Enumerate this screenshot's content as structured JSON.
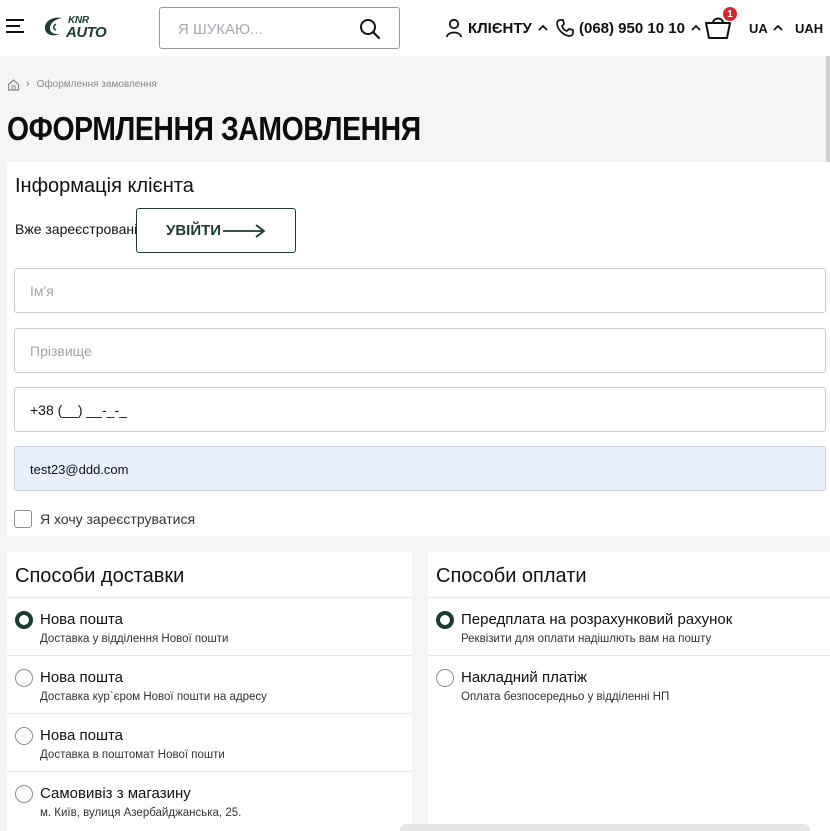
{
  "header": {
    "logo_top": "KNR",
    "logo_bottom": "AUTO",
    "search_placeholder": "Я ШУКАЮ...",
    "client_label": "КЛІЄНТУ",
    "phone": "(068) 950 10 10",
    "cart_count": "1",
    "language": "UA",
    "currency": "UAH"
  },
  "breadcrumb": {
    "current": "Оформлення замовлення"
  },
  "page_title": "ОФОРМЛЕННЯ ЗАМОВЛЕННЯ",
  "client_info": {
    "title": "Інформація клієнта",
    "registered_question": "Вже зареєстровані?",
    "login_label": "УВІЙТИ",
    "first_name_placeholder": "Ім'я",
    "last_name_placeholder": "Прізвище",
    "phone_value": "+38 (__) __-_-_",
    "email_value": "test23@ddd.com",
    "register_checkbox_label": "Я хочу зареєструватися"
  },
  "delivery": {
    "title": "Способи доставки",
    "options": [
      {
        "name": "Нова пошта",
        "description": "Доставка у відділення Нової пошти",
        "selected": true
      },
      {
        "name": "Нова пошта",
        "description": "Доставка кур`єром Нової пошти на адресу",
        "selected": false
      },
      {
        "name": "Нова пошта",
        "description": "Доставка в поштомат Нової пошти",
        "selected": false
      },
      {
        "name": "Самовивіз з магазину",
        "description": "м. Київ, вулиця Азербайджанська, 25.",
        "selected": false
      }
    ]
  },
  "payment": {
    "title": "Способи оплати",
    "options": [
      {
        "name": "Передплата на розрахунковий рахунок",
        "description": "Реквізити для оплати надішлють вам на пошту",
        "selected": true
      },
      {
        "name": "Накладний платіж",
        "description": "Оплата безпосередньо у відділенні НП",
        "selected": false
      }
    ]
  },
  "colors": {
    "brand_green": "#1a3d2f",
    "badge_red": "#d6262b",
    "autofill_bg": "#e8f0fe"
  }
}
